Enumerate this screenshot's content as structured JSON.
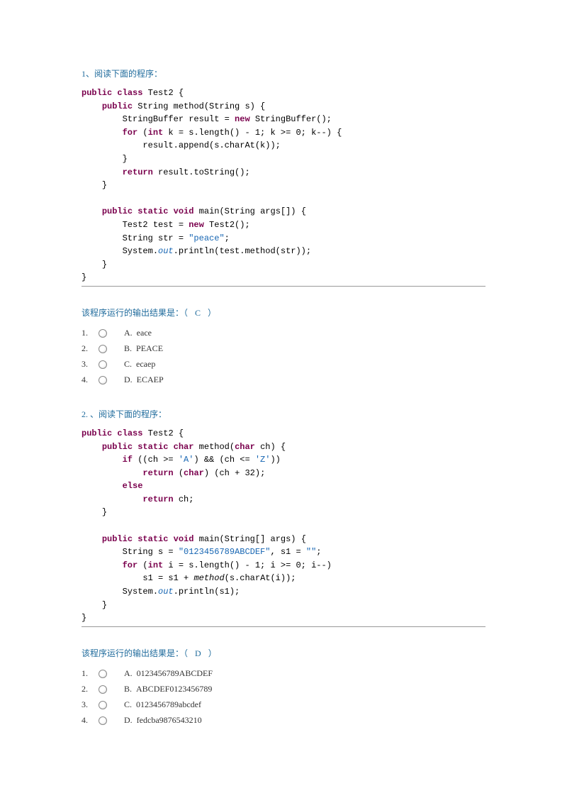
{
  "q1": {
    "title": "1、阅读下面的程序：",
    "code": {
      "l1a": "public",
      "l1b": " class",
      "l1c": " Test2 {",
      "l2a": "public",
      "l2b": " String method(String s) {",
      "l3a": "StringBuffer result = ",
      "l3b": "new",
      "l3c": " StringBuffer();",
      "l4a": "for",
      "l4b": " (",
      "l4c": "int",
      "l4d": " k = s.length() - 1; k >= 0; k--) {",
      "l5": "result.append(s.charAt(k));",
      "l6": "}",
      "l7a": "return",
      "l7b": " result.toString();",
      "l8": "}",
      "l9a": "public",
      "l9b": " static",
      "l9c": " void",
      "l9d": " main(String args[]) {",
      "l10a": "Test2 test = ",
      "l10b": "new",
      "l10c": " Test2();",
      "l11a": "String str = ",
      "l11b": "\"peace\"",
      "l11c": ";",
      "l12a": "System.",
      "l12b": "out",
      "l12c": ".println(test.method(str));",
      "l13": "}",
      "l14": "}"
    },
    "prompt_prefix": "该程序运行的输出结果是：（",
    "answer": "C",
    "prompt_suffix": "）",
    "options": [
      {
        "num": "1.",
        "letter": "A.",
        "text": "eace"
      },
      {
        "num": "2.",
        "letter": "B.",
        "text": "PEACE"
      },
      {
        "num": "3.",
        "letter": "C.",
        "text": "ecaep"
      },
      {
        "num": "4.",
        "letter": "D.",
        "text": "ECAEP"
      }
    ]
  },
  "q2": {
    "title": "2. 、阅读下面的程序：",
    "code": {
      "l1a": "public",
      "l1b": " class",
      "l1c": " Test2 {",
      "l2a": "public",
      "l2b": " static",
      "l2c": " char",
      "l2d": " method(",
      "l2e": "char",
      "l2f": " ch) {",
      "l3a": "if",
      "l3b": " ((ch >= ",
      "l3c": "'A'",
      "l3d": ") && (ch <= ",
      "l3e": "'Z'",
      "l3f": "))",
      "l4a": "return",
      "l4b": " (",
      "l4c": "char",
      "l4d": ") (ch + 32);",
      "l5a": "else",
      "l6a": "return",
      "l6b": " ch;",
      "l7": "}",
      "l8a": "public",
      "l8b": " static",
      "l8c": " void",
      "l8d": " main(String[] args) {",
      "l9a": "String s = ",
      "l9b": "\"0123456789ABCDEF\"",
      "l9c": ", s1 = ",
      "l9d": "\"\"",
      "l9e": ";",
      "l10a": "for",
      "l10b": " (",
      "l10c": "int",
      "l10d": " i = s.length() - 1; i >= 0; i--)",
      "l11a": "s1 = s1 + ",
      "l11b": "method",
      "l11c": "(s.charAt(i));",
      "l12a": "System.",
      "l12b": "out",
      "l12c": ".println(s1);",
      "l13": "}",
      "l14": "}"
    },
    "prompt_prefix": "该程序运行的输出结果是：（",
    "answer": "D",
    "prompt_suffix": "）",
    "options": [
      {
        "num": "1.",
        "letter": "A.",
        "text": "0123456789ABCDEF"
      },
      {
        "num": "2.",
        "letter": "B.",
        "text": "ABCDEF0123456789"
      },
      {
        "num": "3.",
        "letter": "C.",
        "text": "0123456789abcdef"
      },
      {
        "num": "4.",
        "letter": "D.",
        "text": "fedcba9876543210"
      }
    ]
  }
}
